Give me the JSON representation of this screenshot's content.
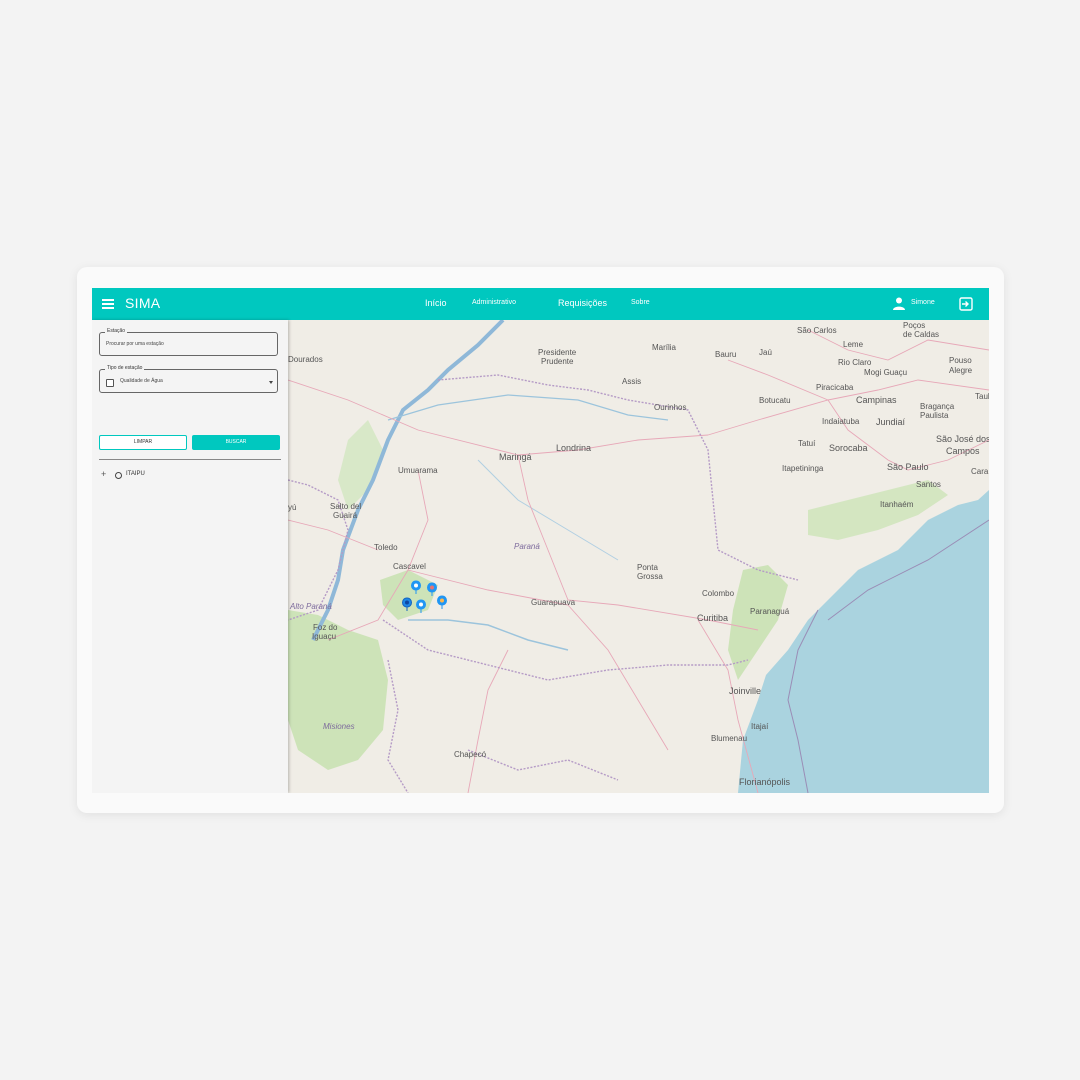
{
  "app": {
    "title": "SIMA"
  },
  "nav": {
    "items": [
      {
        "label": "Início"
      },
      {
        "label": "Administrativo"
      },
      {
        "label": "Requisições"
      },
      {
        "label": "Sobre"
      }
    ]
  },
  "user": {
    "name": "Simone"
  },
  "sidebar": {
    "station_field": {
      "label": "Estação",
      "placeholder": "Procurar por uma estação"
    },
    "type_field": {
      "label": "Tipo de estação",
      "value": "Qualidade de Água",
      "checked": false
    },
    "clear_label": "LIMPAR",
    "search_label": "BUSCAR",
    "tree": [
      {
        "label": "ITAIPU"
      }
    ]
  },
  "map": {
    "cities": [
      {
        "label": "Dourados"
      },
      {
        "label": "Presidente"
      },
      {
        "label": "Prudente"
      },
      {
        "label": "Marília"
      },
      {
        "label": "Bauru"
      },
      {
        "label": "Jaú"
      },
      {
        "label": "São Carlos"
      },
      {
        "label": "Poços"
      },
      {
        "label": "de Caldas"
      },
      {
        "label": "Leme"
      },
      {
        "label": "Rio Claro"
      },
      {
        "label": "Mogi Guaçu"
      },
      {
        "label": "Pouso"
      },
      {
        "label": "Alegre"
      },
      {
        "label": "Assis"
      },
      {
        "label": "Ourinhos"
      },
      {
        "label": "Botucatu"
      },
      {
        "label": "Piracicaba"
      },
      {
        "label": "Campinas"
      },
      {
        "label": "Bragança"
      },
      {
        "label": "Paulista"
      },
      {
        "label": "Indaiatuba"
      },
      {
        "label": "Jundiaí"
      },
      {
        "label": "Maringá"
      },
      {
        "label": "Londrina"
      },
      {
        "label": "Tatuí"
      },
      {
        "label": "Sorocaba"
      },
      {
        "label": "São José dos"
      },
      {
        "label": "Campos"
      },
      {
        "label": "Umuarama"
      },
      {
        "label": "Itapetininga"
      },
      {
        "label": "São Paulo"
      },
      {
        "label": "Cara"
      },
      {
        "label": "Santos"
      },
      {
        "label": "Itanhaém"
      },
      {
        "label": "Salto del"
      },
      {
        "label": "Guairá"
      },
      {
        "label": "Paraná"
      },
      {
        "label": "Toledo"
      },
      {
        "label": "Cascavel"
      },
      {
        "label": "Ponta"
      },
      {
        "label": "Grossa"
      },
      {
        "label": "Colombo"
      },
      {
        "label": "Guarapuava"
      },
      {
        "label": "Alto Paraná"
      },
      {
        "label": "Curitiba"
      },
      {
        "label": "Paranaguá"
      },
      {
        "label": "Foz do"
      },
      {
        "label": "Iguaçu"
      },
      {
        "label": "Joinville"
      },
      {
        "label": "Misiones"
      },
      {
        "label": "Itajaí"
      },
      {
        "label": "Blumenau"
      },
      {
        "label": "Chapecó"
      },
      {
        "label": "Florianópolis"
      },
      {
        "label": "yú"
      },
      {
        "label": "Taul"
      }
    ],
    "markers": [
      {
        "name": "station-1",
        "color": "#2196f3"
      },
      {
        "name": "station-2",
        "color": "#2196f3"
      },
      {
        "name": "station-3",
        "color": "#2196f3"
      },
      {
        "name": "station-4",
        "color": "#2196f3"
      },
      {
        "name": "station-5",
        "color": "#2196f3"
      }
    ]
  },
  "colors": {
    "accent": "#00c8bf",
    "water": "#aad3df",
    "land": "#f0ede6",
    "forest": "#c8dfb0"
  }
}
